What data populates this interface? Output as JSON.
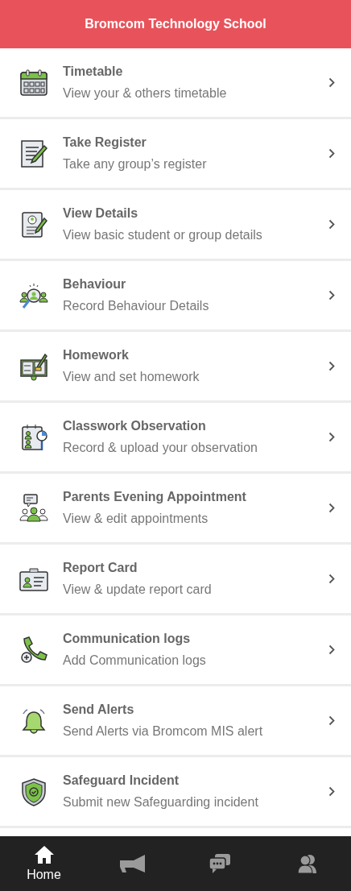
{
  "header": {
    "title": "Bromcom Technology School"
  },
  "menu": [
    {
      "title": "Timetable",
      "subtitle": "View your & others timetable"
    },
    {
      "title": "Take Register",
      "subtitle": "Take any group’s register"
    },
    {
      "title": "View Details",
      "subtitle": "View basic student or group details"
    },
    {
      "title": "Behaviour",
      "subtitle": "Record Behaviour Details"
    },
    {
      "title": "Homework",
      "subtitle": "View and set homework"
    },
    {
      "title": "Classwork Observation",
      "subtitle": "Record & upload your observation"
    },
    {
      "title": "Parents Evening Appointment",
      "subtitle": "View & edit appointments"
    },
    {
      "title": "Report Card",
      "subtitle": "View & update report card"
    },
    {
      "title": "Communication logs",
      "subtitle": "Add Communication logs"
    },
    {
      "title": "Send Alerts",
      "subtitle": "Send Alerts via Bromcom MIS alert"
    },
    {
      "title": "Safeguard Incident",
      "subtitle": "Submit new Safeguarding incident"
    }
  ],
  "bottom_nav": [
    {
      "label": "Home",
      "selected": true
    },
    {
      "selected": false
    },
    {
      "selected": false
    },
    {
      "selected": false
    }
  ]
}
